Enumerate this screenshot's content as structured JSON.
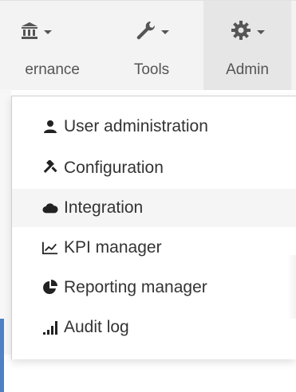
{
  "navbar": {
    "items": [
      {
        "label": "ernance",
        "icon": "institution-icon"
      },
      {
        "label": "Tools",
        "icon": "wrench-icon"
      },
      {
        "label": "Admin",
        "icon": "gear-icon"
      }
    ]
  },
  "admin_menu": {
    "items": [
      {
        "label": "User administration",
        "icon": "user-icon"
      },
      {
        "label": "Configuration",
        "icon": "gavel-icon"
      },
      {
        "label": "Integration",
        "icon": "cloud-icon",
        "highlighted": true
      },
      {
        "label": "KPI manager",
        "icon": "line-chart-icon"
      },
      {
        "label": "Reporting manager",
        "icon": "pie-chart-icon"
      },
      {
        "label": "Audit log",
        "icon": "signal-icon"
      }
    ]
  },
  "colors": {
    "navbar_bg": "#f3f3f3",
    "active_tab_bg": "#e6e6e6",
    "text": "#333333",
    "muted_text": "#555555",
    "accent": "#4f7fc4"
  }
}
